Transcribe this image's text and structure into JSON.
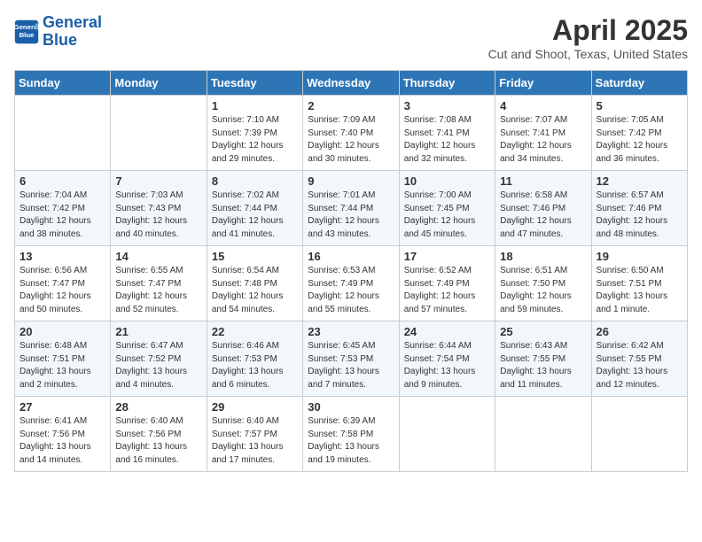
{
  "header": {
    "logo_line1": "General",
    "logo_line2": "Blue",
    "month": "April 2025",
    "location": "Cut and Shoot, Texas, United States"
  },
  "days_of_week": [
    "Sunday",
    "Monday",
    "Tuesday",
    "Wednesday",
    "Thursday",
    "Friday",
    "Saturday"
  ],
  "weeks": [
    [
      {
        "day": "",
        "info": ""
      },
      {
        "day": "",
        "info": ""
      },
      {
        "day": "1",
        "info": "Sunrise: 7:10 AM\nSunset: 7:39 PM\nDaylight: 12 hours\nand 29 minutes."
      },
      {
        "day": "2",
        "info": "Sunrise: 7:09 AM\nSunset: 7:40 PM\nDaylight: 12 hours\nand 30 minutes."
      },
      {
        "day": "3",
        "info": "Sunrise: 7:08 AM\nSunset: 7:41 PM\nDaylight: 12 hours\nand 32 minutes."
      },
      {
        "day": "4",
        "info": "Sunrise: 7:07 AM\nSunset: 7:41 PM\nDaylight: 12 hours\nand 34 minutes."
      },
      {
        "day": "5",
        "info": "Sunrise: 7:05 AM\nSunset: 7:42 PM\nDaylight: 12 hours\nand 36 minutes."
      }
    ],
    [
      {
        "day": "6",
        "info": "Sunrise: 7:04 AM\nSunset: 7:42 PM\nDaylight: 12 hours\nand 38 minutes."
      },
      {
        "day": "7",
        "info": "Sunrise: 7:03 AM\nSunset: 7:43 PM\nDaylight: 12 hours\nand 40 minutes."
      },
      {
        "day": "8",
        "info": "Sunrise: 7:02 AM\nSunset: 7:44 PM\nDaylight: 12 hours\nand 41 minutes."
      },
      {
        "day": "9",
        "info": "Sunrise: 7:01 AM\nSunset: 7:44 PM\nDaylight: 12 hours\nand 43 minutes."
      },
      {
        "day": "10",
        "info": "Sunrise: 7:00 AM\nSunset: 7:45 PM\nDaylight: 12 hours\nand 45 minutes."
      },
      {
        "day": "11",
        "info": "Sunrise: 6:58 AM\nSunset: 7:46 PM\nDaylight: 12 hours\nand 47 minutes."
      },
      {
        "day": "12",
        "info": "Sunrise: 6:57 AM\nSunset: 7:46 PM\nDaylight: 12 hours\nand 48 minutes."
      }
    ],
    [
      {
        "day": "13",
        "info": "Sunrise: 6:56 AM\nSunset: 7:47 PM\nDaylight: 12 hours\nand 50 minutes."
      },
      {
        "day": "14",
        "info": "Sunrise: 6:55 AM\nSunset: 7:47 PM\nDaylight: 12 hours\nand 52 minutes."
      },
      {
        "day": "15",
        "info": "Sunrise: 6:54 AM\nSunset: 7:48 PM\nDaylight: 12 hours\nand 54 minutes."
      },
      {
        "day": "16",
        "info": "Sunrise: 6:53 AM\nSunset: 7:49 PM\nDaylight: 12 hours\nand 55 minutes."
      },
      {
        "day": "17",
        "info": "Sunrise: 6:52 AM\nSunset: 7:49 PM\nDaylight: 12 hours\nand 57 minutes."
      },
      {
        "day": "18",
        "info": "Sunrise: 6:51 AM\nSunset: 7:50 PM\nDaylight: 12 hours\nand 59 minutes."
      },
      {
        "day": "19",
        "info": "Sunrise: 6:50 AM\nSunset: 7:51 PM\nDaylight: 13 hours\nand 1 minute."
      }
    ],
    [
      {
        "day": "20",
        "info": "Sunrise: 6:48 AM\nSunset: 7:51 PM\nDaylight: 13 hours\nand 2 minutes."
      },
      {
        "day": "21",
        "info": "Sunrise: 6:47 AM\nSunset: 7:52 PM\nDaylight: 13 hours\nand 4 minutes."
      },
      {
        "day": "22",
        "info": "Sunrise: 6:46 AM\nSunset: 7:53 PM\nDaylight: 13 hours\nand 6 minutes."
      },
      {
        "day": "23",
        "info": "Sunrise: 6:45 AM\nSunset: 7:53 PM\nDaylight: 13 hours\nand 7 minutes."
      },
      {
        "day": "24",
        "info": "Sunrise: 6:44 AM\nSunset: 7:54 PM\nDaylight: 13 hours\nand 9 minutes."
      },
      {
        "day": "25",
        "info": "Sunrise: 6:43 AM\nSunset: 7:55 PM\nDaylight: 13 hours\nand 11 minutes."
      },
      {
        "day": "26",
        "info": "Sunrise: 6:42 AM\nSunset: 7:55 PM\nDaylight: 13 hours\nand 12 minutes."
      }
    ],
    [
      {
        "day": "27",
        "info": "Sunrise: 6:41 AM\nSunset: 7:56 PM\nDaylight: 13 hours\nand 14 minutes."
      },
      {
        "day": "28",
        "info": "Sunrise: 6:40 AM\nSunset: 7:56 PM\nDaylight: 13 hours\nand 16 minutes."
      },
      {
        "day": "29",
        "info": "Sunrise: 6:40 AM\nSunset: 7:57 PM\nDaylight: 13 hours\nand 17 minutes."
      },
      {
        "day": "30",
        "info": "Sunrise: 6:39 AM\nSunset: 7:58 PM\nDaylight: 13 hours\nand 19 minutes."
      },
      {
        "day": "",
        "info": ""
      },
      {
        "day": "",
        "info": ""
      },
      {
        "day": "",
        "info": ""
      }
    ]
  ]
}
